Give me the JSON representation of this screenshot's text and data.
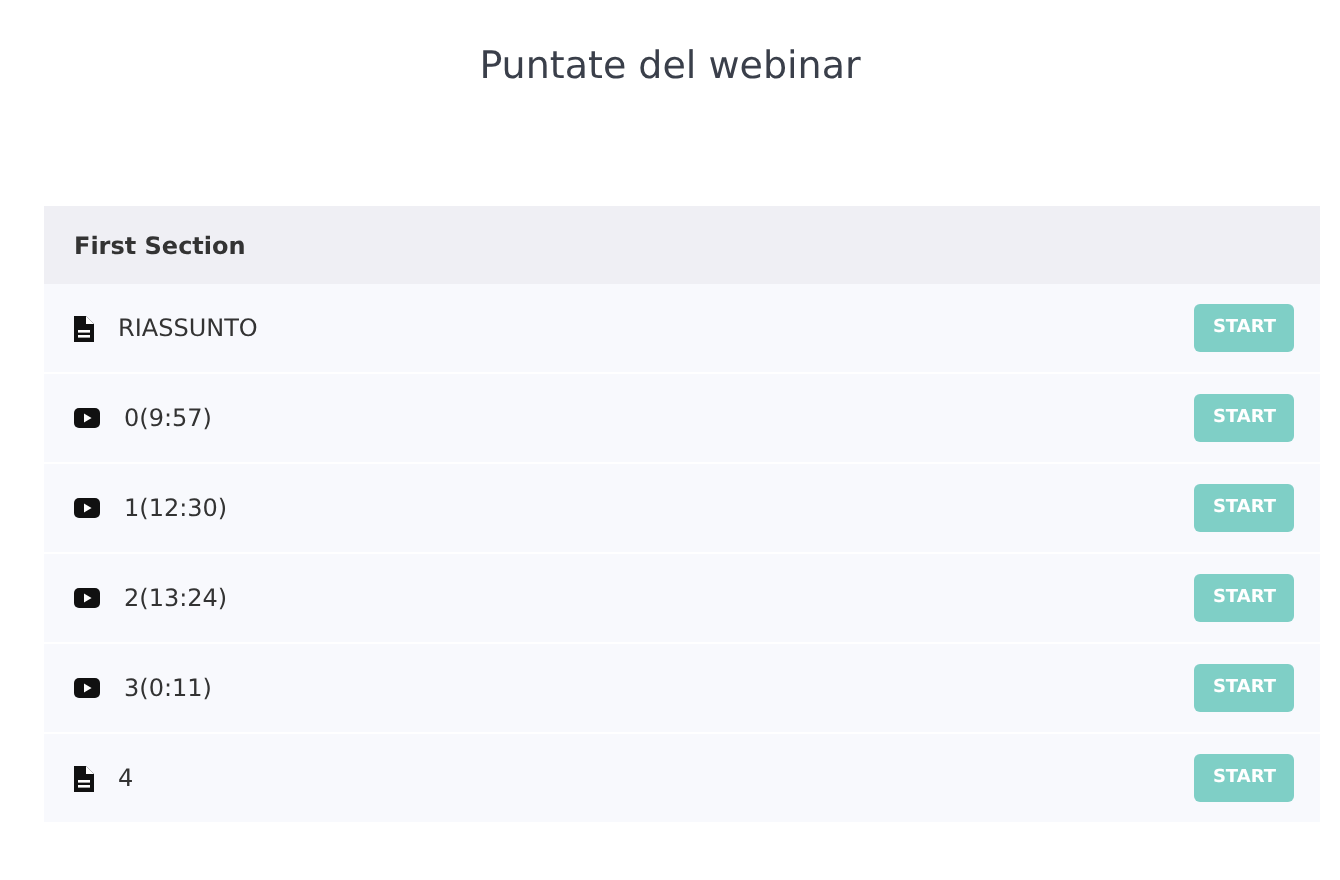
{
  "title": "Puntate del webinar",
  "section": {
    "title": "First Section",
    "lessons": [
      {
        "kind": "document",
        "label": "RIASSUNTO",
        "button": "START"
      },
      {
        "kind": "video",
        "label": "0(9:57)",
        "button": "START"
      },
      {
        "kind": "video",
        "label": "1(12:30)",
        "button": "START"
      },
      {
        "kind": "video",
        "label": "2(13:24)",
        "button": "START"
      },
      {
        "kind": "video",
        "label": "3(0:11)",
        "button": "START"
      },
      {
        "kind": "document",
        "label": "4",
        "button": "START"
      }
    ]
  }
}
